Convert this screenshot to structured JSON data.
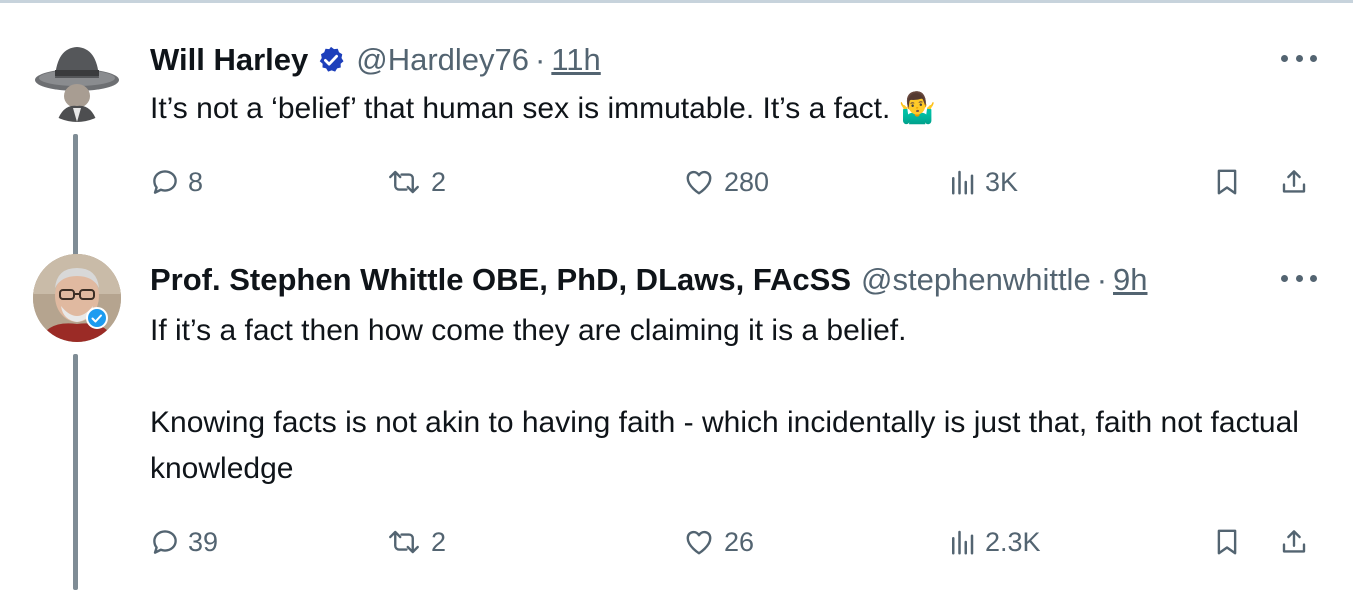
{
  "tweets": [
    {
      "name": "Will Harley",
      "handle": "@Hardley76",
      "separator": "·",
      "time": "11h",
      "text": "It’s not a ‘belief’ that human sex is immutable. It’s a fact.",
      "emoji": "🤷‍♂️",
      "verified_color": "#1d3fbb",
      "stats": {
        "replies": "8",
        "retweets": "2",
        "likes": "280",
        "views": "3K"
      }
    },
    {
      "name": "Prof. Stephen Whittle OBE, PhD, DLaws, FAcSS",
      "handle": "@stephenwhittle",
      "separator": "·",
      "time": "9h",
      "text": "If it’s a fact then how come they are claiming it is a belief.\n\nKnowing facts is not akin to having faith - which incidentally is just that, faith not factual knowledge",
      "verified_color": "#1d9bf0",
      "stats": {
        "replies": "39",
        "retweets": "2",
        "likes": "26",
        "views": "2.3K"
      }
    }
  ],
  "icons": {
    "reply": "reply-icon",
    "retweet": "retweet-icon",
    "like": "heart-icon",
    "views": "views-icon",
    "bookmark": "bookmark-icon",
    "share": "share-icon",
    "more": "more-icon"
  },
  "colors": {
    "text": "#0f1419",
    "secondary": "#536471",
    "thread_line": "#7f8c95"
  }
}
